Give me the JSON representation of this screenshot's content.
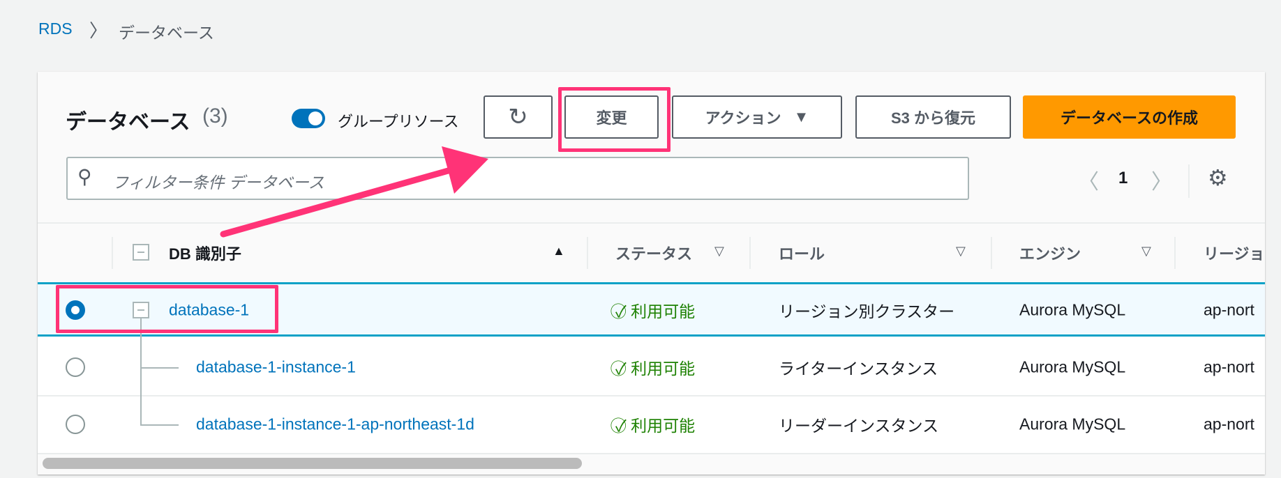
{
  "breadcrumb": {
    "root": "RDS",
    "current": "データベース"
  },
  "header": {
    "title": "データベース",
    "count": "(3)",
    "group_toggle_label": "グループリソース",
    "group_toggle_on": true
  },
  "buttons": {
    "modify": "変更",
    "actions": "アクション",
    "restore_s3": "S3 から復元",
    "create": "データベースの作成"
  },
  "search": {
    "placeholder": "フィルター条件 データベース"
  },
  "pagination": {
    "page": "1"
  },
  "columns": [
    "DB 識別子",
    "ステータス",
    "ロール",
    "エンジン",
    "リージョ"
  ],
  "rows": [
    {
      "name": "database-1",
      "status": "利用可能",
      "role": "リージョン別クラスター",
      "engine": "Aurora MySQL",
      "region": "ap-nort",
      "selected": true
    },
    {
      "name": "database-1-instance-1",
      "status": "利用可能",
      "role": "ライターインスタンス",
      "engine": "Aurora MySQL",
      "region": "ap-nort",
      "selected": false
    },
    {
      "name": "database-1-instance-1-ap-northeast-1d",
      "status": "利用可能",
      "role": "リーダーインスタンス",
      "engine": "Aurora MySQL",
      "region": "ap-nort",
      "selected": false
    }
  ],
  "colors": {
    "accent": "#0073bb",
    "primary": "#ff9900",
    "success": "#1d8102",
    "annotation": "#ff3377"
  }
}
